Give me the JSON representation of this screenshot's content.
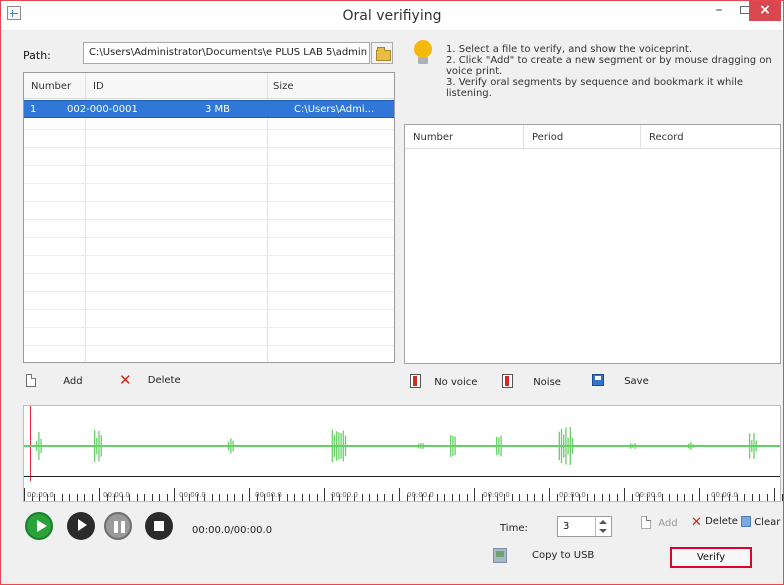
{
  "window": {
    "title": "Oral verifiying",
    "controls": {
      "minimize": "–",
      "maximize": "□",
      "close": "×"
    }
  },
  "path": {
    "label": "Path:",
    "value": "C:\\Users\\Administrator\\Documents\\e PLUS LAB 5\\admin"
  },
  "file_table": {
    "headers": [
      "Number",
      "ID",
      "Size",
      ""
    ],
    "rows": [
      {
        "number": "1",
        "id": "002-000-0001",
        "size": "3 MB",
        "path": "C:\\Users\\Admi..."
      }
    ]
  },
  "instructions": {
    "line1": "1. Select a file to verify, and show the voiceprint.",
    "line2": "2. Click \"Add\" to create a new segment or by mouse dragging on voice print.",
    "line3": "3. Verify oral segments by sequence and bookmark it while listening."
  },
  "segment_table": {
    "headers": [
      "Number",
      "Period",
      "Record"
    ]
  },
  "toolbar": {
    "add_label": "Add",
    "delete_label": "Delete",
    "no_voice_label": "No voice",
    "noise_label": "Noise",
    "save_label": "Save"
  },
  "waveform": {
    "ruler_labels": [
      "00:00.0",
      "00:00.0",
      "00:00.0",
      "00:00.0",
      "00:00.0",
      "00:00.0",
      "00:00.0",
      "00:00.0",
      "00:00.0",
      "00:00.0"
    ]
  },
  "playback": {
    "time_display": "00:00.0/00:00.0",
    "time_label": "Time:",
    "time_value": "3",
    "add_label": "Add",
    "delete_label": "Delete",
    "clear_label": "Clear",
    "copy_usb_label": "Copy to USB",
    "verify_label": "Verify"
  },
  "colors": {
    "waveform": "#65d065",
    "selection": "#3077d7",
    "accent_red": "#e3002b"
  }
}
